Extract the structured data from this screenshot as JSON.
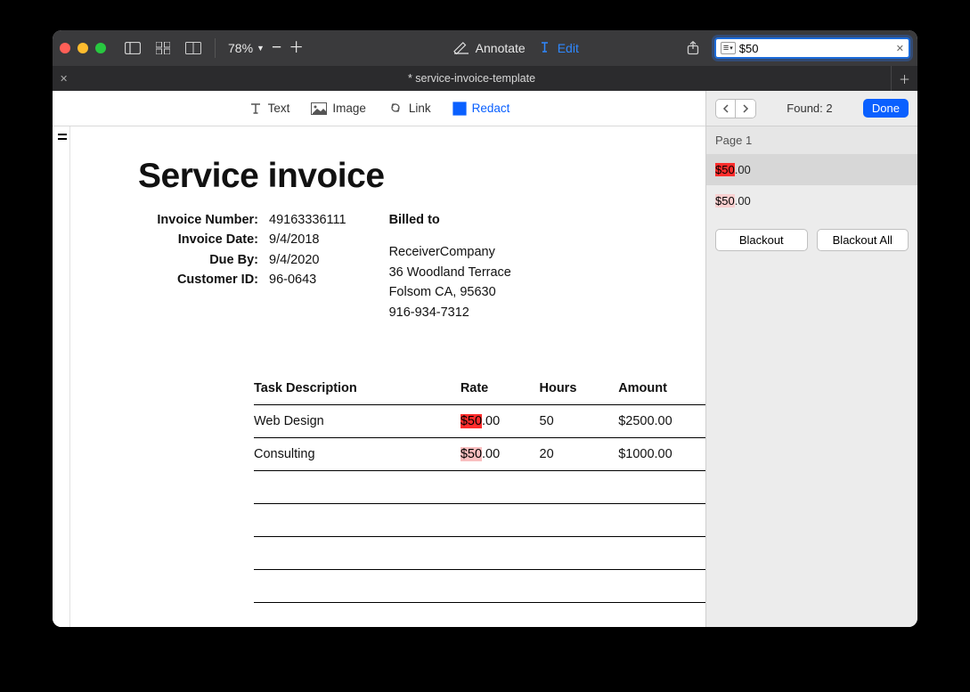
{
  "toolbar": {
    "zoom": "78%",
    "annotate": "Annotate",
    "edit": "Edit",
    "search_value": "$50"
  },
  "tab": {
    "title": "* service-invoice-template"
  },
  "doctools": {
    "text": "Text",
    "image": "Image",
    "link": "Link",
    "redact": "Redact"
  },
  "sidebar": {
    "found_label": "Found: 2",
    "done": "Done",
    "page_header": "Page 1",
    "results": [
      {
        "hl": "$50",
        "rest": ".00"
      },
      {
        "hl": "$50",
        "rest": ".00"
      }
    ],
    "blackout": "Blackout",
    "blackout_all": "Blackout All"
  },
  "doc": {
    "title": "Service invoice",
    "labels": {
      "invoice_number": "Invoice Number:",
      "invoice_date": "Invoice Date:",
      "due_by": "Due By:",
      "customer_id": "Customer ID:"
    },
    "values": {
      "invoice_number": "49163336111",
      "invoice_date": "9/4/2018",
      "due_by": "9/4/2020",
      "customer_id": "96-0643"
    },
    "billed_label": "Billed to",
    "billed": {
      "name": "ReceiverCompany",
      "street": "36 Woodland Terrace",
      "city": "Folsom CA, 95630",
      "phone": "916-934-7312"
    },
    "table": {
      "headers": {
        "task": "Task Description",
        "rate": "Rate",
        "hours": "Hours",
        "amount": "Amount"
      },
      "rows": [
        {
          "task": "Web Design",
          "rate_hl": "$50",
          "rate_rest": ".00",
          "rate_hl_class": "hl",
          "hours": "50",
          "amount": "$2500.00"
        },
        {
          "task": "Consulting",
          "rate_hl": "$50",
          "rate_rest": ".00",
          "rate_hl_class": "hl soft",
          "hours": "20",
          "amount": "$1000.00"
        }
      ],
      "blank_rows": 4
    }
  }
}
